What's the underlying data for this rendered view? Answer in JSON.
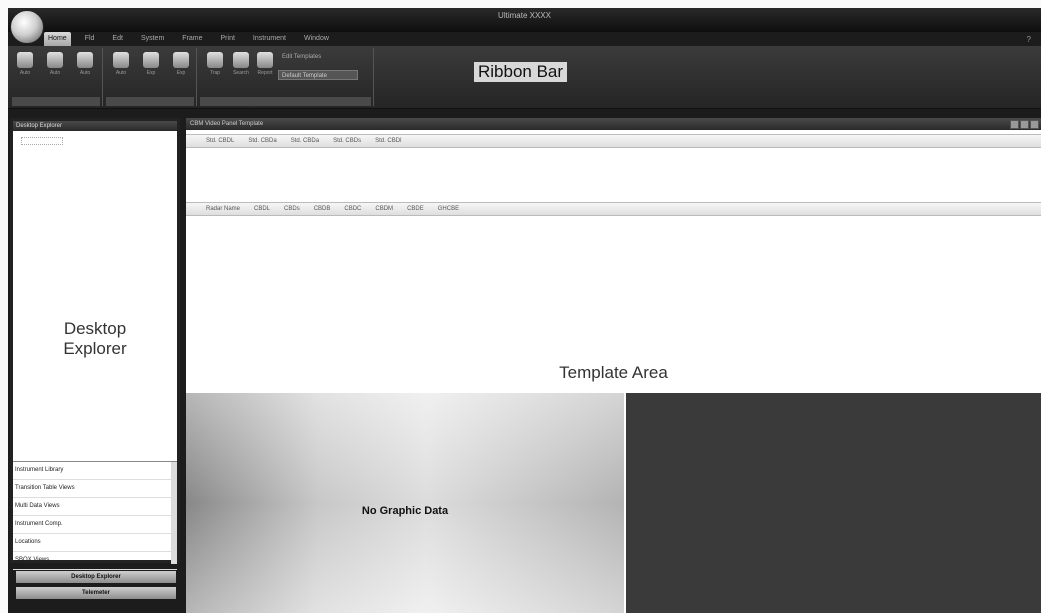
{
  "window": {
    "title": "Ultimate XXXX"
  },
  "ribbon_tabs": [
    "Home",
    "Fld",
    "Edt",
    "System",
    "Frame",
    "Print",
    "Instrument",
    "Window"
  ],
  "ribbon": {
    "label": "Ribbon Bar",
    "groups": [
      {
        "label": "",
        "buttons": [
          "Auto",
          "Auto",
          "Auto"
        ]
      },
      {
        "label": "",
        "buttons": [
          "Auto",
          "Exp",
          "Exp"
        ]
      },
      {
        "label": "",
        "buttons": [
          "Trap",
          "Search",
          "Report"
        ]
      }
    ],
    "link_text": "Edit Templates",
    "dropdown_value": "Default Template"
  },
  "explorer": {
    "header": "Desktop Explorer",
    "label_line1": "Desktop",
    "label_line2": "Explorer",
    "list_items": [
      "Instrument Library",
      "Transition Table Views",
      "Multi Data Views",
      "Instrument Comp.",
      "Locations",
      "SBOX Views"
    ],
    "bottom_buttons": [
      "Desktop Explorer",
      "Telemeter"
    ]
  },
  "template": {
    "title": "CBM Video Panel Template",
    "label": "Template Area",
    "row1_cols": [
      "Std. CBDL",
      "Std. CBDa",
      "Std. CBDa",
      "Std. CBDs",
      "Std. CBDl"
    ],
    "row2_cols": [
      "Radar Name",
      "CBDL",
      "CBDs",
      "CBDB",
      "CBDC",
      "CBDM",
      "CBDE",
      "GHCBE"
    ],
    "no_graphic": "No Graphic Data"
  }
}
